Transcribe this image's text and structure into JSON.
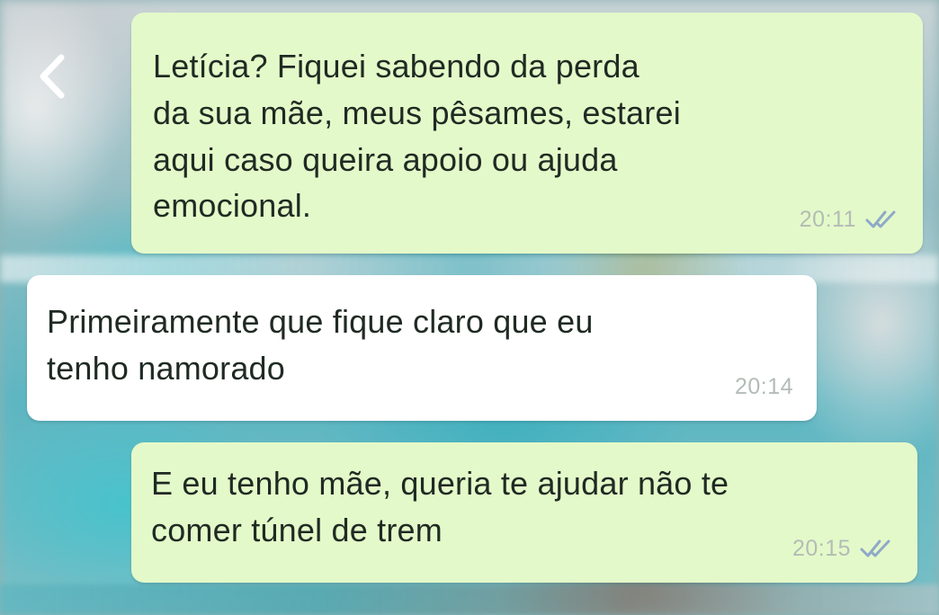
{
  "nav": {
    "back_icon": "chevron-left-icon",
    "more_icon": "more-horizontal-icon"
  },
  "colors": {
    "outgoing_bubble": "#e4f9c9",
    "incoming_bubble": "#ffffff",
    "text": "#1f2a23",
    "meta": "#b3bcb6",
    "read_ticks": "#8fa9c9"
  },
  "messages": [
    {
      "direction": "outgoing",
      "text": "Letícia? Fiquei sabendo da perda\nda sua mãe, meus pêsames, estarei\naqui caso queira apoio ou ajuda\nemocional.",
      "time": "20:11",
      "status_icon": "double-check-icon"
    },
    {
      "direction": "incoming",
      "text": "Primeiramente que fique claro que eu\ntenho namorado",
      "time": "20:14"
    },
    {
      "direction": "outgoing",
      "text": "E eu tenho mãe, queria te ajudar não te\ncomer túnel de trem",
      "time": "20:15",
      "status_icon": "double-check-icon"
    }
  ]
}
